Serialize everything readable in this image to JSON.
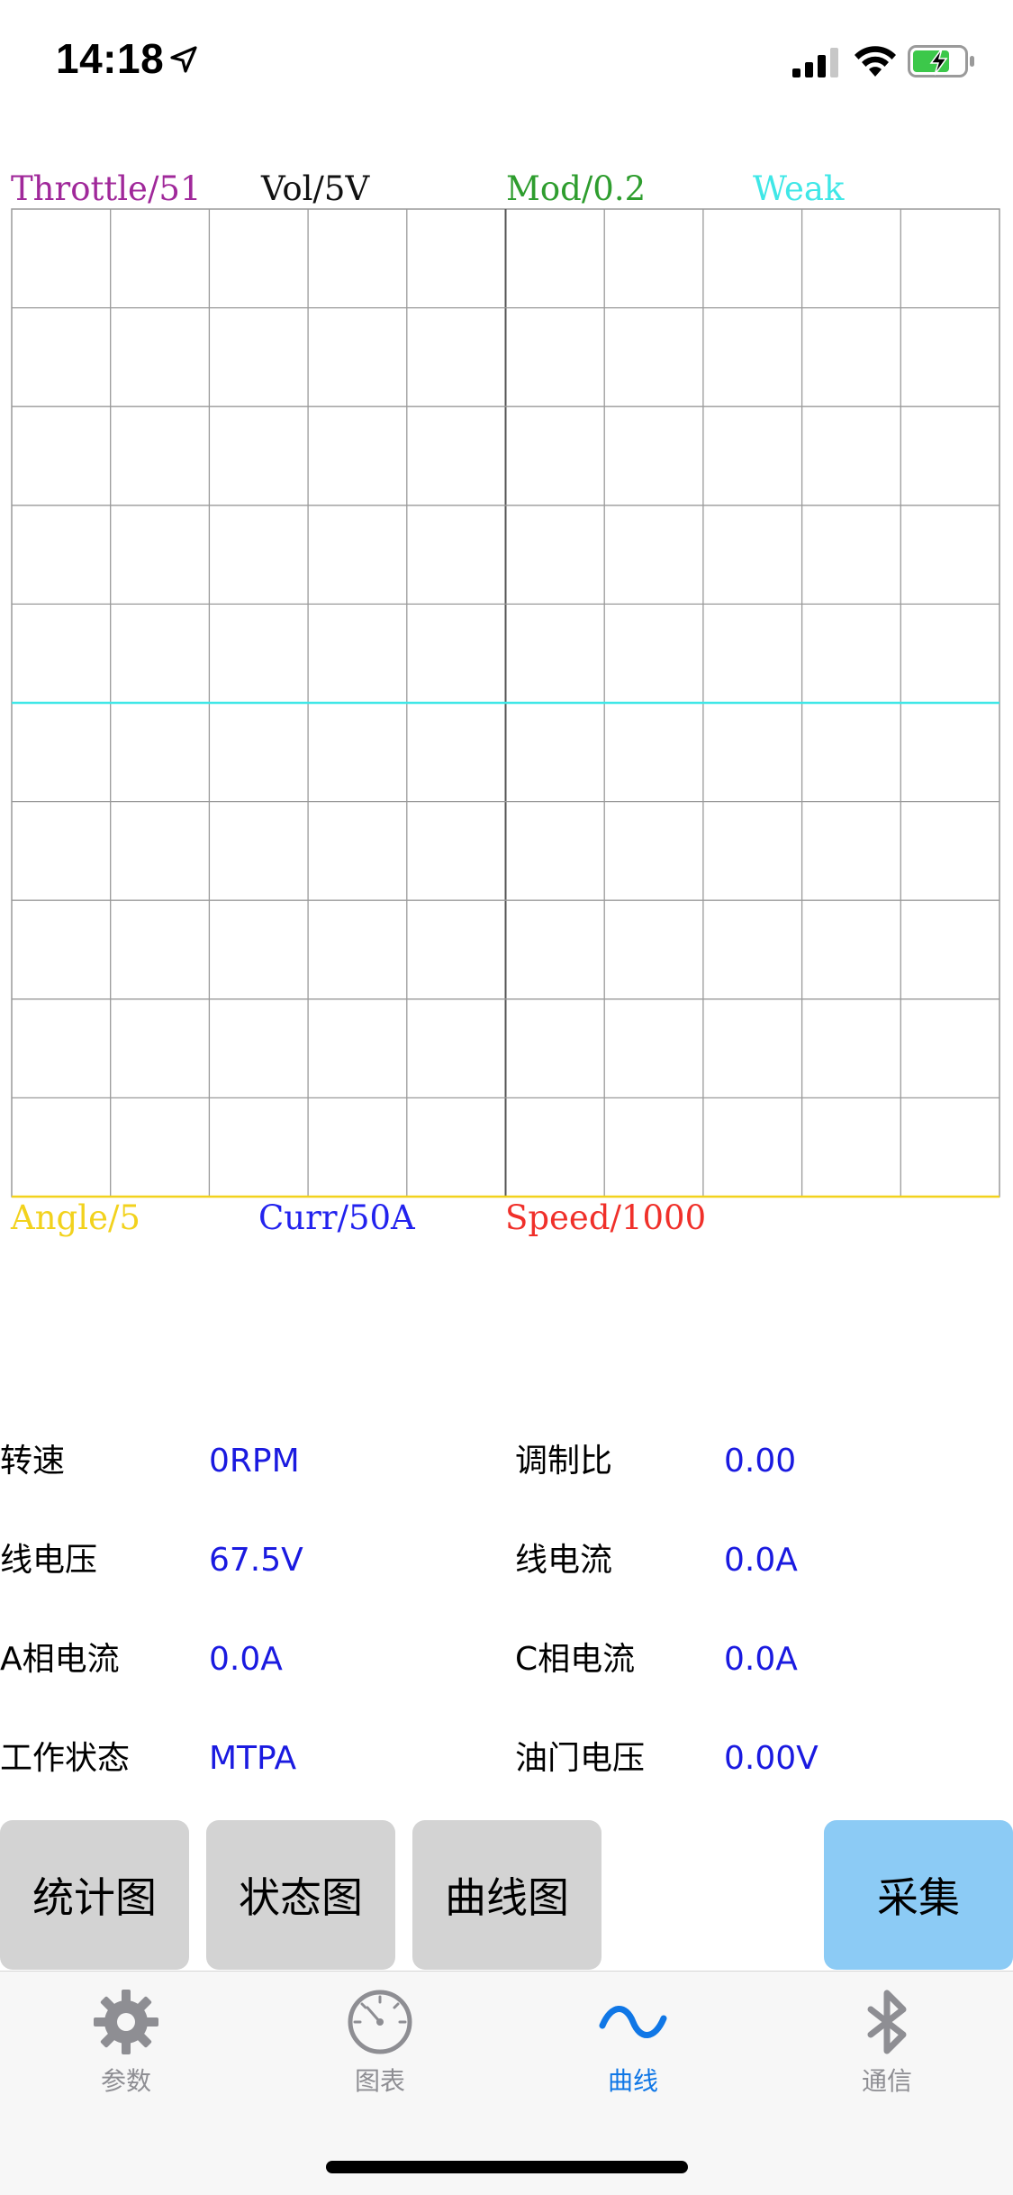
{
  "status_bar": {
    "time": "14:18"
  },
  "chart": {
    "top_labels": [
      {
        "text": "Throttle/51",
        "color": "#a0289a"
      },
      {
        "text": "Vol/5V",
        "color": "#111111"
      },
      {
        "text": "Mod/0.2",
        "color": "#2e9d2e"
      },
      {
        "text": "Weak",
        "color": "#3fe7e7"
      }
    ],
    "bottom_labels": [
      {
        "text": "Angle/5",
        "color": "#f2d21d"
      },
      {
        "text": "Curr/50A",
        "color": "#2222ee"
      },
      {
        "text": "Speed/1000",
        "color": "#f0302a"
      }
    ],
    "grid": {
      "columns": 10,
      "rows": 10,
      "line_color": "#9a9a9a"
    }
  },
  "chart_data": {
    "type": "line",
    "title": "",
    "grid": true,
    "series": [
      {
        "name": "Weak",
        "color": "#3fe7e7",
        "value_in_divisions": 0
      },
      {
        "name": "Angle/5",
        "color": "#f2d21d",
        "value_in_divisions": -5
      }
    ],
    "y_divisions_range": [
      -5,
      5
    ]
  },
  "readings": [
    {
      "label": "转速",
      "value": "0RPM"
    },
    {
      "label": "调制比",
      "value": "0.00"
    },
    {
      "label": "线电压",
      "value": "67.5V"
    },
    {
      "label": "线电流",
      "value": "0.0A"
    },
    {
      "label": "A相电流",
      "value": "0.0A"
    },
    {
      "label": "C相电流",
      "value": "0.0A"
    },
    {
      "label": "工作状态",
      "value": "MTPA"
    },
    {
      "label": "油门电压",
      "value": "0.00V"
    }
  ],
  "buttons": {
    "stats": "统计图",
    "state": "状态图",
    "curve": "曲线图",
    "collect": "采集"
  },
  "tabs": [
    {
      "label": "参数",
      "icon": "gear-icon",
      "active": false
    },
    {
      "label": "图表",
      "icon": "gauge-icon",
      "active": false
    },
    {
      "label": "曲线",
      "icon": "wave-icon",
      "active": true
    },
    {
      "label": "通信",
      "icon": "bluetooth-icon",
      "active": false
    }
  ],
  "colors": {
    "value_blue": "#1a1ae0",
    "button_gray": "#d3d3d3",
    "button_accent": "#8ccbf5",
    "tab_active": "#1077e6",
    "tab_inactive": "#8e8e93"
  }
}
